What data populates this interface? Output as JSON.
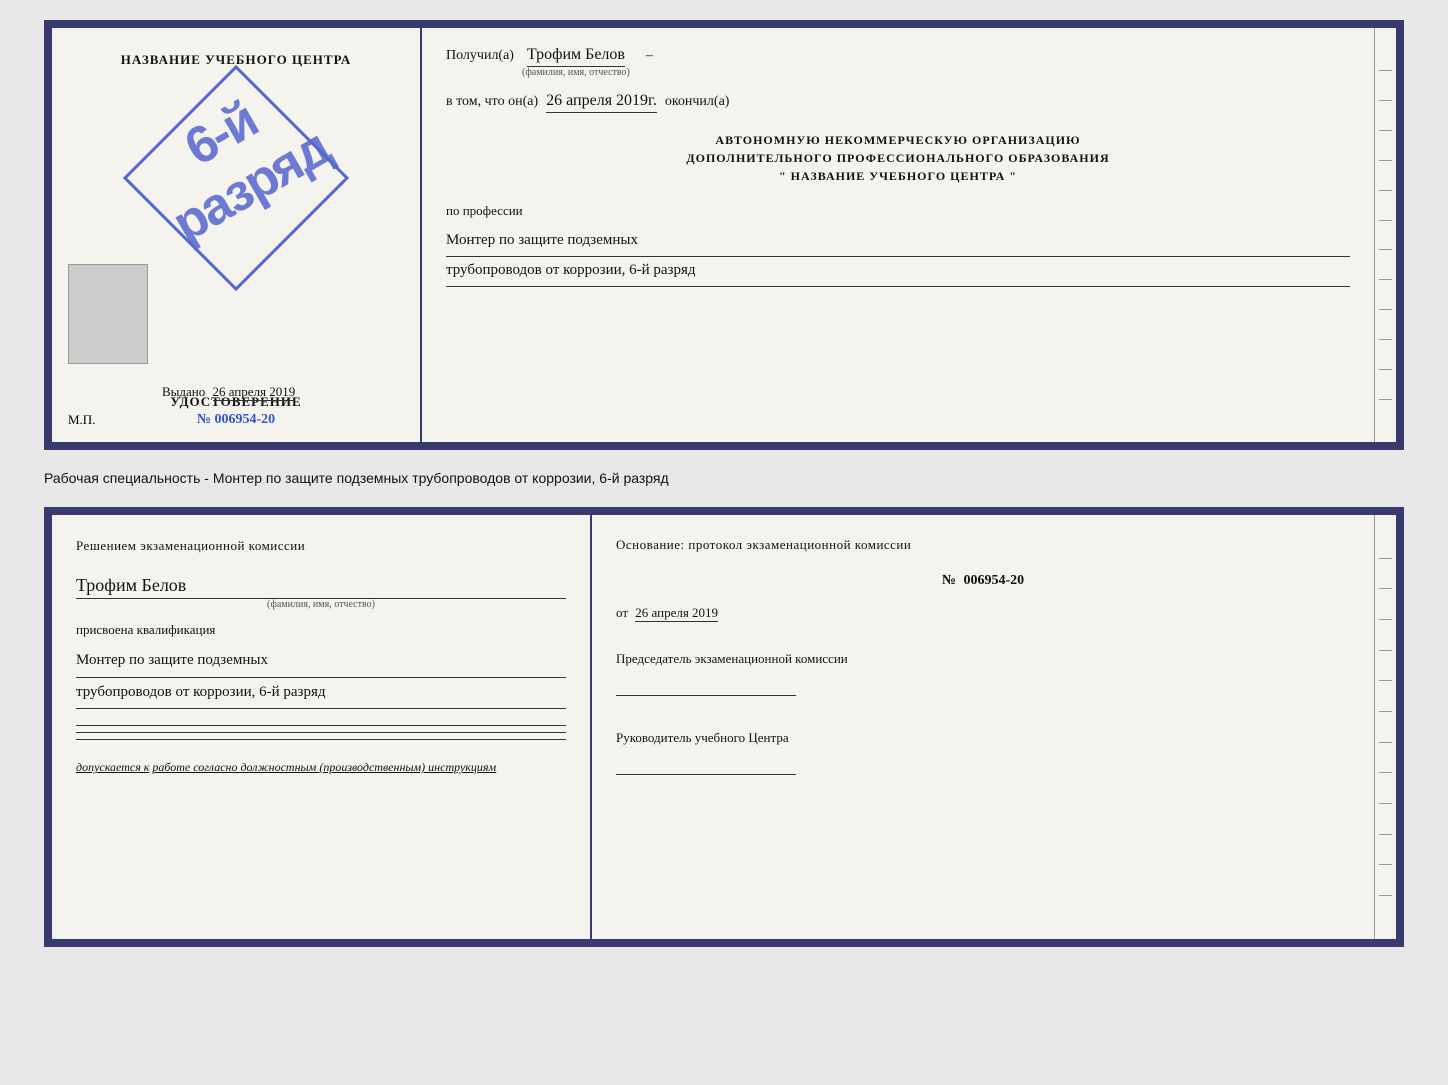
{
  "top_cert": {
    "left": {
      "title": "НАЗВАНИЕ УЧЕБНОГО ЦЕНТРА",
      "stamp_text": "6-й разряд",
      "udost_label": "УДОСТОВЕРЕНИЕ",
      "udost_num_prefix": "№ ",
      "udost_num": "006954-20",
      "vydano_label": "Выдано",
      "vydano_date": "26 апреля 2019",
      "mp_label": "М.П."
    },
    "right": {
      "poluchil_label": "Получил(а)",
      "poluchil_name": "Трофим Белов",
      "poluchil_sub": "(фамилия, имя, отчество)",
      "dash1": "–",
      "vtom_label": "в том, что он(а)",
      "vtom_date": "26 апреля 2019г.",
      "okончил_label": "окончил(а)",
      "org_line1": "АВТОНОМНУЮ НЕКОММЕРЧЕСКУЮ ОРГАНИЗАЦИЮ",
      "org_line2": "ДОПОЛНИТЕЛЬНОГО ПРОФЕССИОНАЛЬНОГО ОБРАЗОВАНИЯ",
      "org_line3": "\"     НАЗВАНИЕ УЧЕБНОГО ЦЕНТРА     \"",
      "po_professii_label": "по профессии",
      "profession_line1": "Монтер по защите подземных",
      "profession_line2": "трубопроводов от коррозии, 6-й разряд"
    }
  },
  "subtitle": {
    "text": "Рабочая специальность - Монтер по защите подземных трубопроводов от коррозии, 6-й разряд"
  },
  "bottom_cert": {
    "left": {
      "title": "Решением экзаменационной комиссии",
      "name": "Трофим Белов",
      "name_sub": "(фамилия, имя, отчество)",
      "assigned_label": "присвоена квалификация",
      "qual_line1": "Монтер по защите подземных",
      "qual_line2": "трубопроводов от коррозии, 6-й разряд",
      "допускается_label": "допускается к",
      "допускается_text": "работе согласно должностным (производственным) инструкциям"
    },
    "right": {
      "osnov_label": "Основание: протокол экзаменационной комиссии",
      "num_label": "№",
      "num_value": "006954-20",
      "ot_label": "от",
      "ot_date": "26 апреля 2019",
      "pred_label": "Председатель экзаменационной комиссии",
      "ruk_label": "Руководитель учебного Центра"
    }
  }
}
